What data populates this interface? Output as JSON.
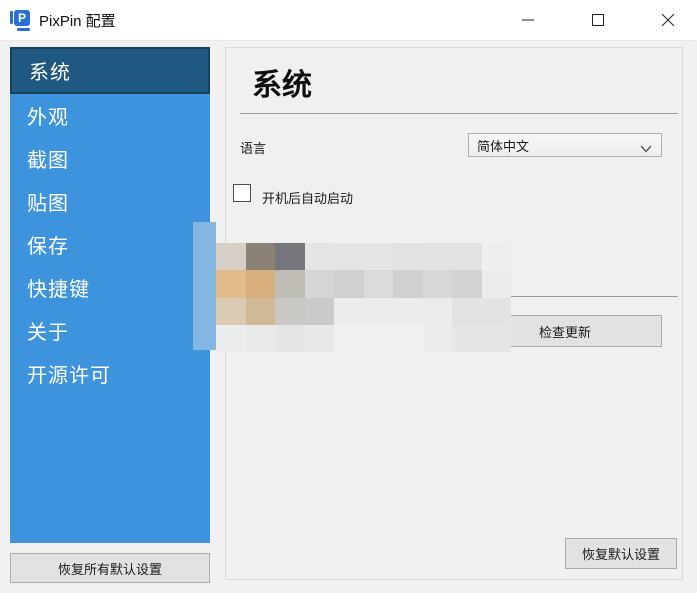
{
  "window": {
    "title": "PixPin 配置"
  },
  "titlebar_controls": {
    "minimize": "minimize",
    "maximize": "maximize",
    "close": "close"
  },
  "sidebar": {
    "items": [
      {
        "label": "系统",
        "selected": true
      },
      {
        "label": "外观",
        "selected": false
      },
      {
        "label": "截图",
        "selected": false
      },
      {
        "label": "贴图",
        "selected": false
      },
      {
        "label": "保存",
        "selected": false
      },
      {
        "label": "快捷键",
        "selected": false
      },
      {
        "label": "关于",
        "selected": false
      },
      {
        "label": "开源许可",
        "selected": false
      }
    ],
    "restore_all_button": "恢复所有默认设置"
  },
  "main": {
    "heading": "系统",
    "language_label": "语言",
    "language_value": "简体中文",
    "autostart_label": "开机后自动启动",
    "autostart_checked": false,
    "check_update_button": "检查更新",
    "restore_defaults_button": "恢复默认设置"
  },
  "colors": {
    "app_icon_blue": "#2a6fd3",
    "sidebar_blue": "#3d94dd",
    "selected_item_bg": "#1f5880",
    "selected_item_border": "#16405c"
  },
  "mosaic": {
    "strip_color": "#84b8e2",
    "rows": [
      [
        "#d5cfc5",
        "#8b8276",
        "#74767b",
        "#e3e5e5",
        "#e4e6e6",
        "#e3e5e6",
        "#e0e2e3",
        "#e2e3e4",
        "#e2e4e4",
        "#efefef"
      ],
      [
        "#e3bc8e",
        "#dbb07f",
        "#c0bdb7",
        "#d4d5d5",
        "#cfd0d0",
        "#dbdbdc",
        "#cfd1d1",
        "#d6d7d7",
        "#d1d2d2",
        "#ebecec"
      ],
      [
        "#dccbb3",
        "#d2b995",
        "#c9c8c4",
        "#c8cbca",
        "#ebecec",
        "#ebecec",
        "#ebecec",
        "#ebecec",
        "#e2e3e3",
        "#e2e3e3"
      ],
      [
        "#eaebeb",
        "#e8e9e9",
        "#e4e6e6",
        "#e7e8e8",
        "#f0f1f1",
        "#f0f1f1",
        "#f0f1f1",
        "#ececec",
        "#e5e6e6",
        "#e5e6e6"
      ]
    ]
  }
}
